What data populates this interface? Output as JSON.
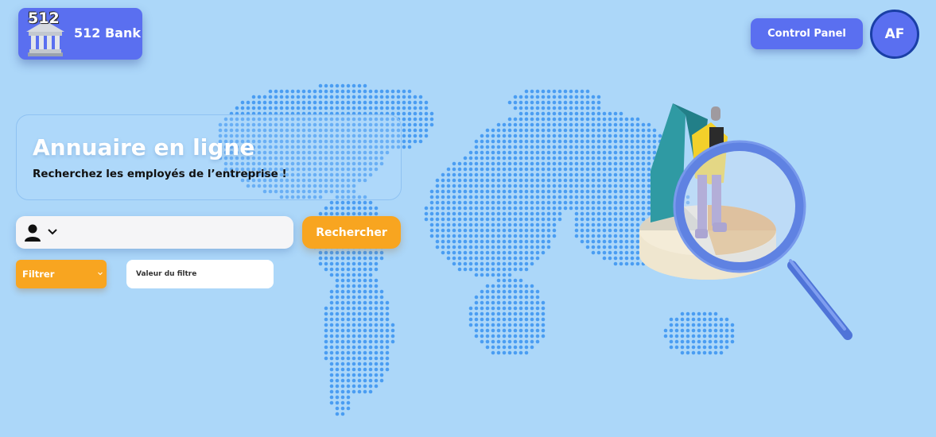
{
  "header": {
    "logo_number": "512",
    "brand_name": "512 Bank",
    "control_panel_label": "Control Panel",
    "avatar_initials": "AF"
  },
  "hero": {
    "title": "Annuaire en ligne",
    "subtitle": "Recherchez les employés de l’entreprise !"
  },
  "search": {
    "input_value": "",
    "field_icon": "user-icon",
    "button_label": "Rechercher"
  },
  "filter": {
    "selected_label": "Filtrer",
    "value_placeholder": "Valeur du filtre"
  },
  "colors": {
    "background": "#acd7f9",
    "primary": "#5a6ff0",
    "accent": "#f8a520",
    "map_dots": "#4a9df2"
  }
}
